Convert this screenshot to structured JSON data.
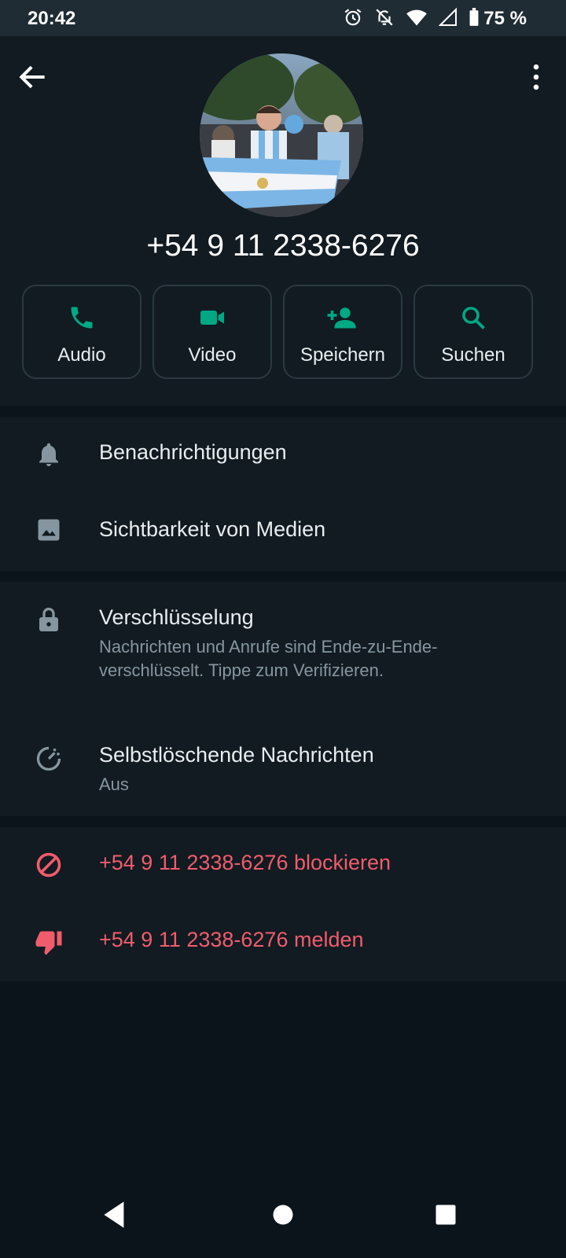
{
  "status_bar": {
    "time": "20:42",
    "battery": "75 %",
    "icons": [
      "alarm-icon",
      "notifications-off-icon",
      "wifi-icon",
      "signal-icon",
      "battery-icon"
    ]
  },
  "header": {
    "back_icon": "arrow-back-icon",
    "menu_icon": "more-vert-icon",
    "avatar": "profile-photo",
    "phone": "+54 9 11 2338-6276"
  },
  "actions": [
    {
      "label": "Audio",
      "icon": "phone-icon"
    },
    {
      "label": "Video",
      "icon": "videocam-icon"
    },
    {
      "label": "Speichern",
      "icon": "person-add-icon"
    },
    {
      "label": "Suchen",
      "icon": "search-icon"
    }
  ],
  "settings": {
    "notifications": "Benachrichtigungen",
    "media_visibility": "Sichtbarkeit von Medien",
    "encryption_title": "Verschlüsselung",
    "encryption_sub": "Nachrichten und Anrufe sind Ende-zu-Ende-verschlüsselt. Tippe zum Verifizieren.",
    "disappearing_title": "Selbstlöschende Nachrichten",
    "disappearing_sub": "Aus"
  },
  "danger": {
    "block": "+54 9 11 2338-6276 blockieren",
    "report": "+54 9 11 2338-6276 melden"
  },
  "colors": {
    "accent": "#00a884",
    "danger": "#f15c6d",
    "background": "#0b141a",
    "surface": "#111b21"
  }
}
